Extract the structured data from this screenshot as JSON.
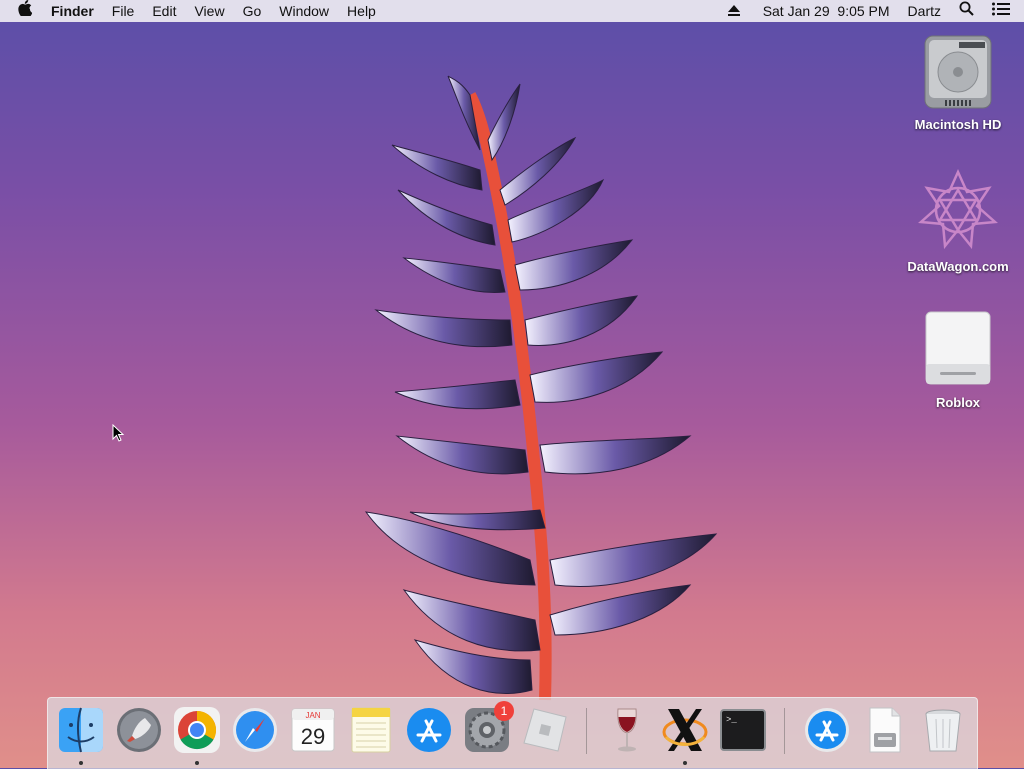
{
  "menubar": {
    "apple_icon": "apple-icon",
    "app_name": "Finder",
    "items": [
      "File",
      "Edit",
      "View",
      "Go",
      "Window",
      "Help"
    ],
    "datetime": "Sat Jan 29  9:05 PM",
    "user": "Dartz"
  },
  "desktop": {
    "items": [
      {
        "label": "Macintosh HD",
        "icon": "hard-drive-icon"
      },
      {
        "label": "DataWagon.com",
        "icon": "disk-image-icon"
      },
      {
        "label": "Roblox",
        "icon": "external-drive-icon"
      }
    ]
  },
  "dock": {
    "items": [
      {
        "name": "Finder",
        "icon": "finder-icon",
        "running": true
      },
      {
        "name": "Launchpad",
        "icon": "launchpad-icon",
        "running": false
      },
      {
        "name": "Google Chrome",
        "icon": "chrome-icon",
        "running": true
      },
      {
        "name": "Safari",
        "icon": "safari-icon",
        "running": false
      },
      {
        "name": "Calendar",
        "icon": "calendar-icon",
        "running": false,
        "month": "JAN",
        "day": "29"
      },
      {
        "name": "Notes",
        "icon": "notes-icon",
        "running": false
      },
      {
        "name": "App Store",
        "icon": "app-store-icon",
        "running": false
      },
      {
        "name": "System Preferences",
        "icon": "system-preferences-icon",
        "running": false,
        "badge": "1"
      },
      {
        "name": "Roblox",
        "icon": "roblox-icon",
        "running": false
      },
      {
        "name": "Wine",
        "icon": "wine-icon",
        "running": false
      },
      {
        "name": "XQuartz",
        "icon": "xquartz-icon",
        "running": true
      },
      {
        "name": "Terminal",
        "icon": "terminal-icon",
        "running": false,
        "prompt": ">_"
      },
      {
        "name": "App Store Downloads",
        "icon": "app-store-folder-icon",
        "running": false
      },
      {
        "name": "Document",
        "icon": "document-icon",
        "running": false
      },
      {
        "name": "Trash",
        "icon": "trash-icon",
        "running": false
      }
    ]
  },
  "colors": {
    "stem": "#e8503a",
    "accent_blue": "#2f8ff0",
    "badge_red": "#f0403a"
  }
}
